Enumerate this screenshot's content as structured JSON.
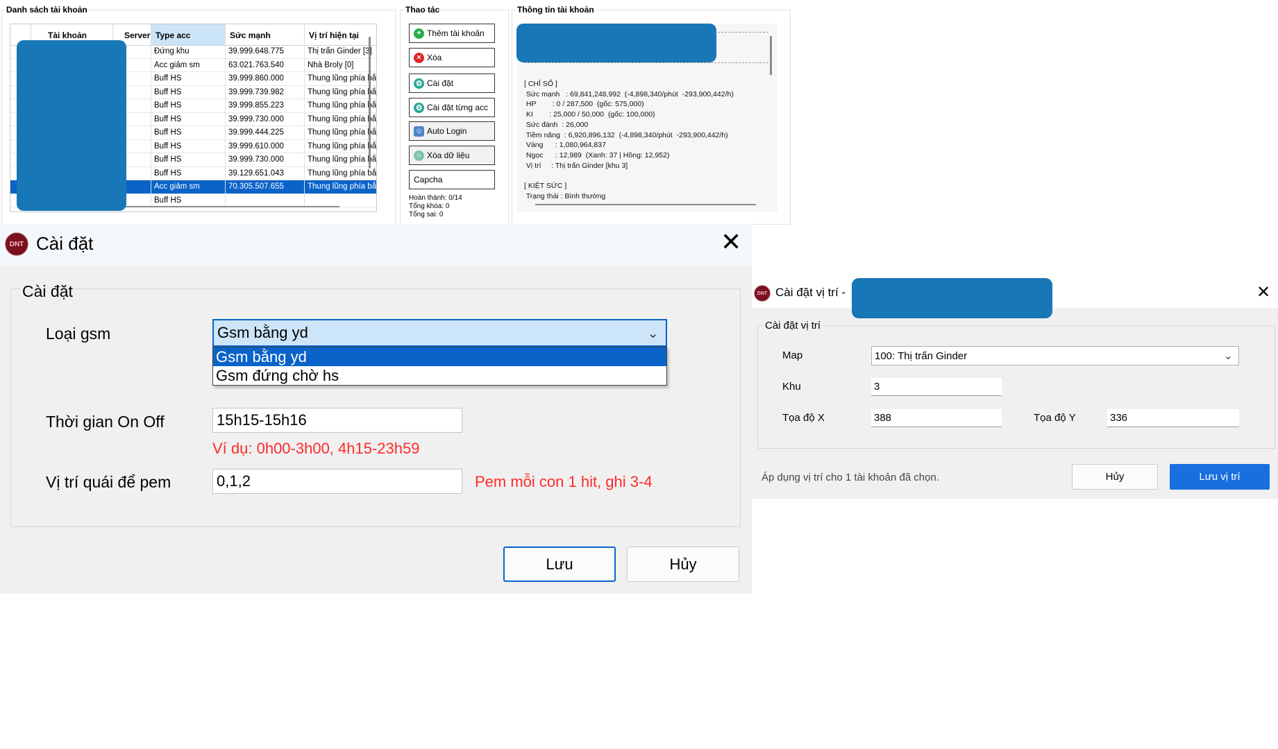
{
  "account_list": {
    "title": "Danh sách tài khoản",
    "columns": [
      "Tài khoản",
      "Server",
      "Type acc",
      "Sức mạnh",
      "Vị trí hiện tại"
    ],
    "rows": [
      {
        "type": "Đứng khu",
        "power": "39.999.648.775",
        "location": "Thị trấn Ginder [3]"
      },
      {
        "type": "Acc giảm sm",
        "power": "63.021.763.540",
        "location": "Nhà Broly [0]"
      },
      {
        "type": "Buff HS",
        "power": "39.999.860.000",
        "location": "Thung lũng phía bắc"
      },
      {
        "type": "Buff HS",
        "power": "39.999.739.982",
        "location": "Thung lũng phía bắc"
      },
      {
        "type": "Buff HS",
        "power": "39.999.855.223",
        "location": "Thung lũng phía bắc"
      },
      {
        "type": "Buff HS",
        "power": "39.999.730.000",
        "location": "Thung lũng phía bắc"
      },
      {
        "type": "Buff HS",
        "power": "39.999.444.225",
        "location": "Thung lũng phía bắc"
      },
      {
        "type": "Buff HS",
        "power": "39.999.610.000",
        "location": "Thung lũng phía bắc"
      },
      {
        "type": "Buff HS",
        "power": "39.999.730.000",
        "location": "Thung lũng phía bắc"
      },
      {
        "type": "Buff HS",
        "power": "39.129.651.043",
        "location": "Thung lũng phía bắc"
      },
      {
        "type": "Acc giảm sm",
        "power": "70.305.507.655",
        "location": "Thung lũng phía bắc",
        "selected": true
      },
      {
        "type": "Buff HS",
        "power": "",
        "location": ""
      }
    ]
  },
  "operations": {
    "title": "Thao tác",
    "buttons": [
      {
        "label": "Thêm tài khoản",
        "icon": "plus-icon"
      },
      {
        "label": "Xóa",
        "icon": "delete-icon"
      },
      {
        "label": "Cài đặt",
        "icon": "gear-icon"
      },
      {
        "label": "Cài đặt từng acc",
        "icon": "gear-icon"
      },
      {
        "label": "Auto Login",
        "icon": "user-icon"
      },
      {
        "label": "Xóa dữ liệu",
        "icon": "clear-icon"
      },
      {
        "label": "Capcha",
        "icon": ""
      }
    ],
    "stats": {
      "done": "Hoàn thành: 0/14",
      "locked": "Tổng khóa: 0",
      "errors": "Tổng sai: 0"
    }
  },
  "account_info": {
    "title": "Thông tin tài khoản",
    "text": "[ CHỈ SỐ ]\n Sức mạnh   : 69,841,248,992  (-4,898,340/phút  -293,900,442/h)\n HP        : 0 / 287,500  (gốc: 575,000)\n KI        : 25,000 / 50,000  (gốc: 100,000)\n Sức đánh  : 26,000\n Tiềm năng  : 6,920,896,132  (-4,898,340/phút  -293,900,442/h)\n Vàng      : 1,080,964,837\n Ngọc      : 12,989  (Xanh: 37 | Hồng: 12,952)\n Vị trí     : Thị trấn Ginder [khu 3]\n\n[ KIỆT SỨC ]\n Trạng thái : Bình thường"
  },
  "settings_dialog": {
    "logo": "DNT",
    "title": "Cài đặt",
    "group": "Cài đặt",
    "gsm_label": "Loại gsm",
    "gsm_selected": "Gsm bằng yd",
    "gsm_options": [
      "Gsm bằng yd",
      "Gsm đứng chờ hs"
    ],
    "onoff_label": "Thời gian On Off",
    "onoff_value": "15h15-15h16",
    "onoff_hint": "Ví dụ: 0h00-3h00, 4h15-23h59",
    "pos_label": "Vị trí quái để pem",
    "pos_value": "0,1,2",
    "pos_hint": "Pem mỗi con 1 hit, ghi 3-4",
    "save": "Lưu",
    "cancel": "Hủy"
  },
  "position_dialog": {
    "logo": "DNT",
    "title": "Cài đặt vị trí -",
    "group": "Cài đặt vị trí",
    "map_label": "Map",
    "map_value": "100: Thị trấn Ginder",
    "zone_label": "Khu",
    "zone_value": "3",
    "x_label": "Tọa độ X",
    "x_value": "388",
    "y_label": "Tọa độ Y",
    "y_value": "336",
    "apply_text": "Áp dụng vị trí cho 1 tài khoản đã chọn.",
    "cancel": "Hủy",
    "save": "Lưu vị trí"
  },
  "colors": {
    "accent": "#0a63c9",
    "redacted": "#1877b6",
    "hint_red": "#ff2a2a",
    "save_blue": "#1a6fe0"
  }
}
